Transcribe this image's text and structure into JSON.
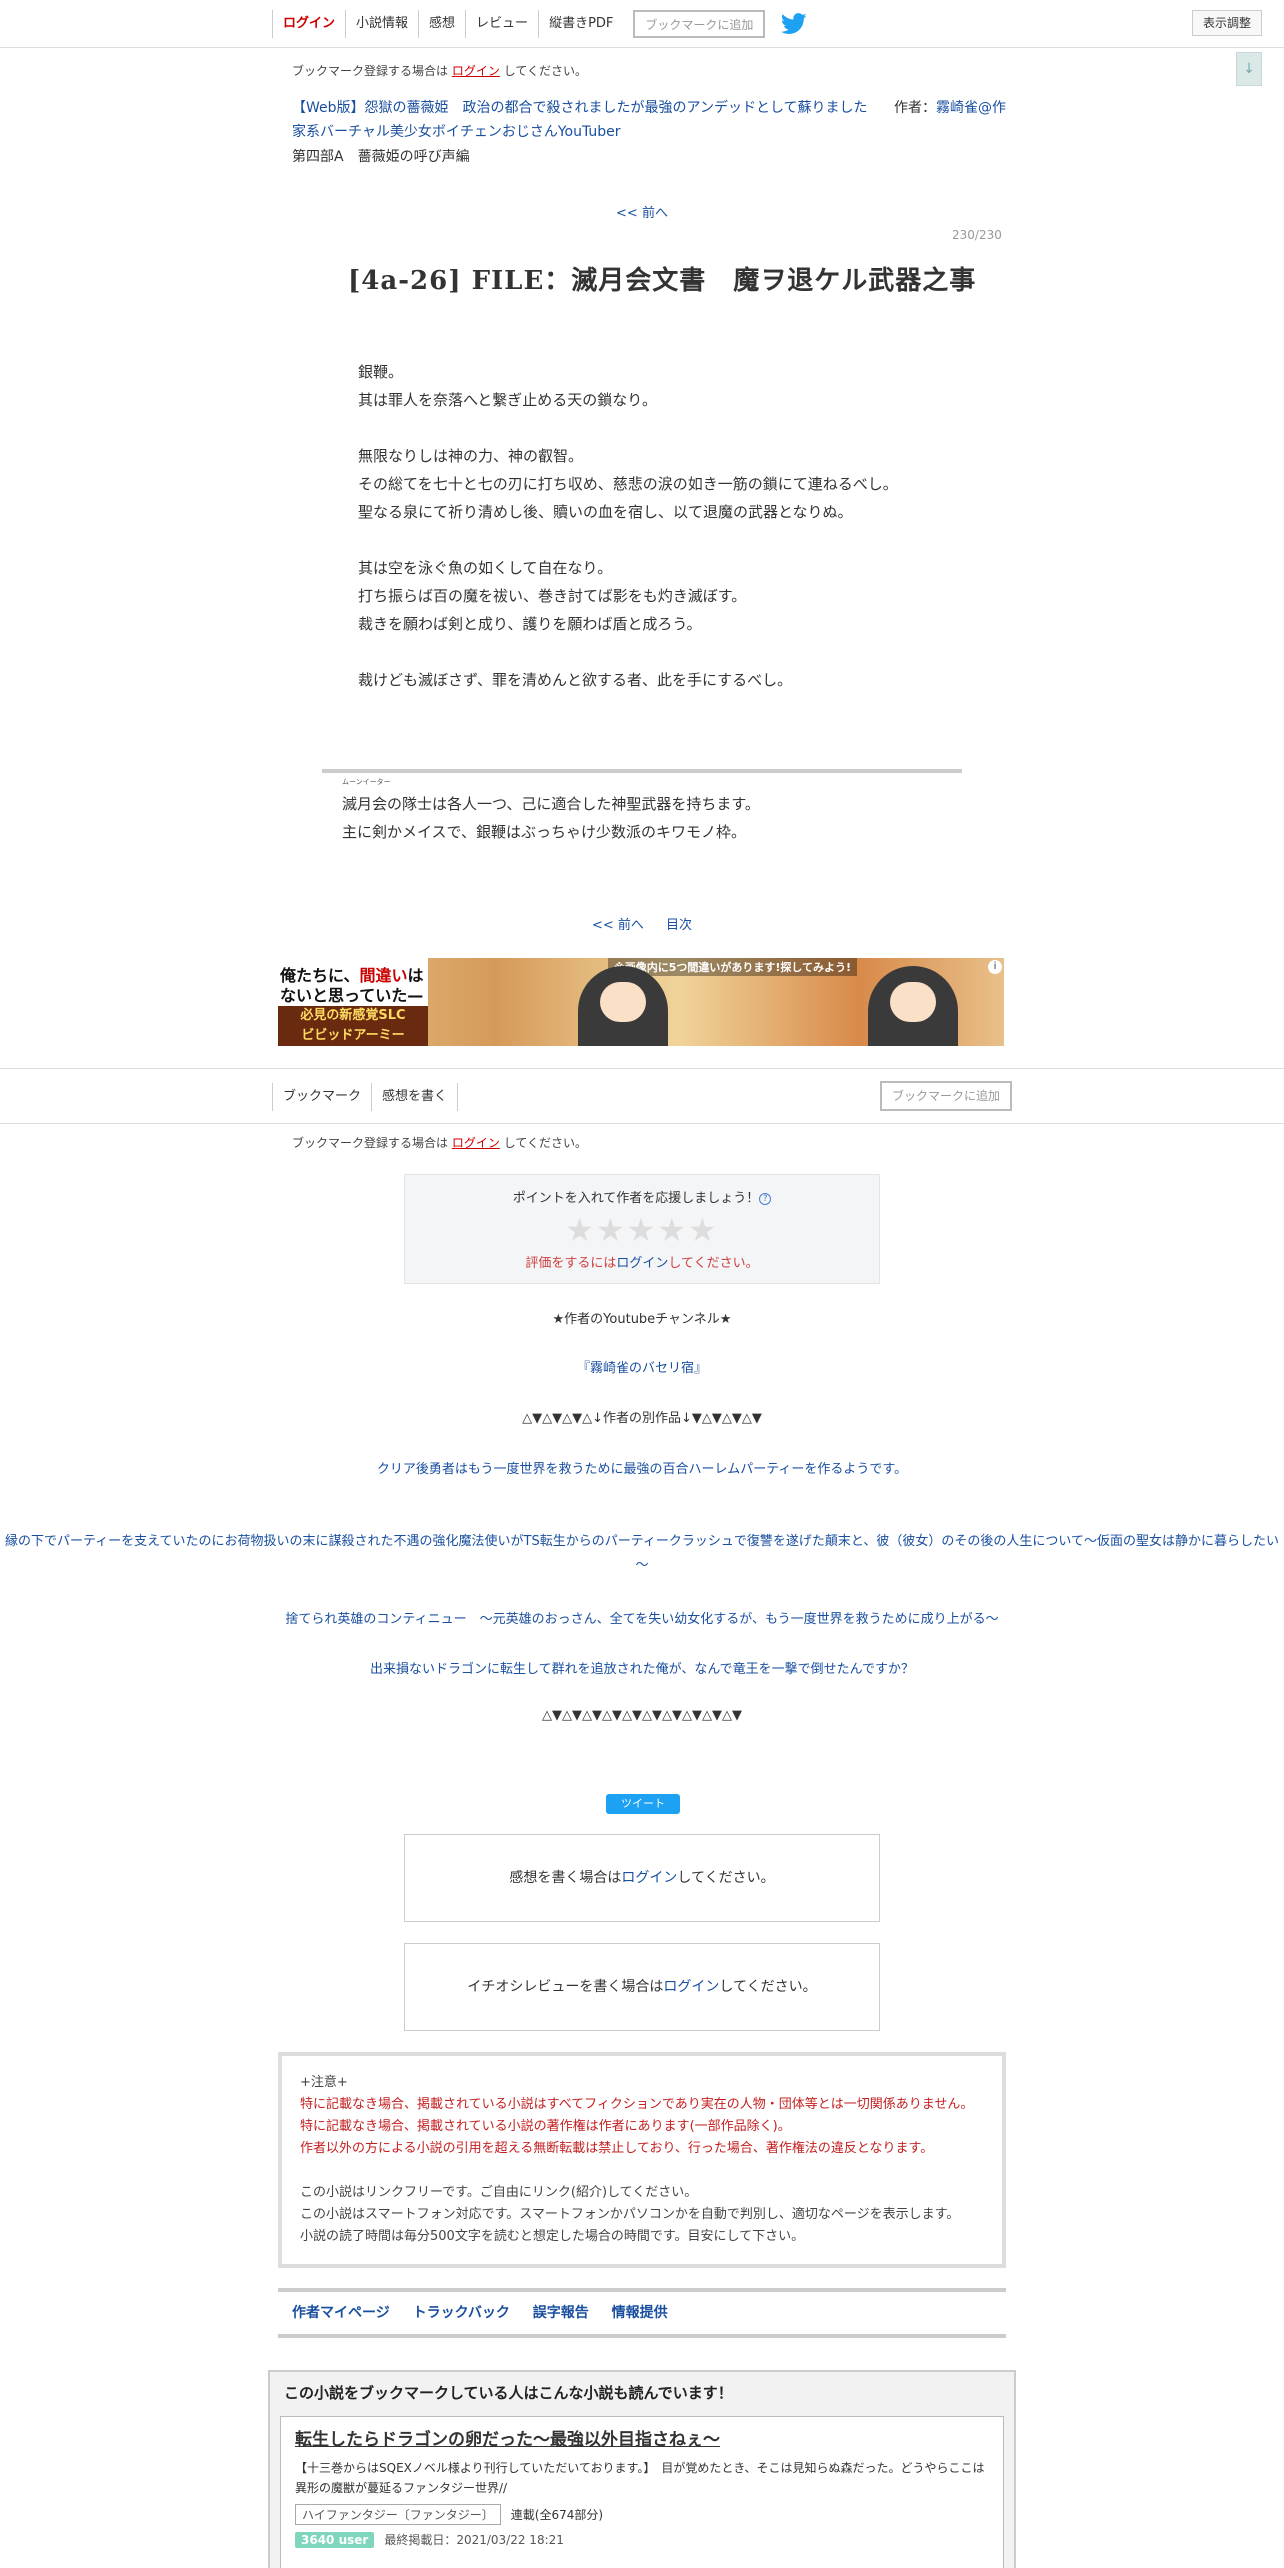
{
  "topnav": {
    "login": "ログイン",
    "novel_info": "小説情報",
    "impressions": "感想",
    "review": "レビュー",
    "vertical_pdf": "縦書きPDF",
    "bookmark_add": "ブックマークに追加",
    "display_settings": "表示調整",
    "scroll_arrow": "↓"
  },
  "bookmark_note": {
    "before": "ブックマーク登録する場合は",
    "login": "ログイン",
    "after": "してください。"
  },
  "novel": {
    "title": "【Web版】怨獄の薔薇姫　政治の都合で殺されましたが最強のアンデッドとして蘇りました",
    "author_label": "作者：",
    "author": "霧崎雀@作家系バーチャル美少女ボイチェンおじさんYouTuber",
    "chapter": "第四部A　薔薇姫の呼び声編"
  },
  "episode": {
    "prev": "<< 前へ",
    "page_count": "230/230",
    "title": "[4a-26] FILE：滅月会文書　魔ヲ退ケル武器之事",
    "body": [
      "銀鞭。",
      "其は罪人を奈落へと繋ぎ止める天の鎖なり。",
      "",
      "無限なりしは神の力、神の叡智。",
      "その総てを七十と七の刃に打ち収め、慈悲の涙の如き一筋の鎖にて連ねるべし。",
      "聖なる泉にて祈り清めし後、贖いの血を宿し、以て退魔の武器となりぬ。",
      "",
      "其は空を泳ぐ魚の如くして自在なり。",
      "打ち振らば百の魔を祓い、巻き討てば影をも灼き滅ぼす。",
      "裁きを願わば剣と成り、護りを願わば盾と成ろう。",
      "",
      "裁けども滅ぼさず、罪を清めんと欲する者、此を手にするべし。"
    ],
    "postscript_ruby_base": "滅月会",
    "postscript_ruby_text": "ムーンイーター",
    "postscript_line1_rest": "の隊士は各人一つ、己に適合した神聖武器を持ちます。",
    "postscript_line2": "主に剣かメイスで、銀鞭はぶっちゃけ少数派のキワモノ枠。",
    "bottom_prev": "<< 前へ",
    "toc": "目次"
  },
  "ad": {
    "line1_a": "俺たちに、",
    "line1_b": "間違い",
    "line1_c": "は",
    "line2": "ないと思っていた—",
    "line3": "必見の新感覚SLC",
    "line4": "ビビッドアーミー",
    "top_text": "※画像内に5つ間違いがあります!探してみよう!",
    "info": "i"
  },
  "subnav": {
    "bookmark": "ブックマーク",
    "write_impression": "感想を書く",
    "bookmark_add": "ブックマークに追加"
  },
  "rating": {
    "question": "ポイントを入れて作者を応援しましょう！",
    "help": "?",
    "stars": "★★★★★",
    "requirement_before": "評価をするには",
    "requirement_login": "ログイン",
    "requirement_after": "してください。"
  },
  "author_links": {
    "youtube_heading": "★作者のYoutubeチャンネル★",
    "youtube_name": "『霧崎雀のバセリ宿』",
    "other_works_heading": "△▼△▼△▼△↓作者の別作品↓▼△▼△▼△▼",
    "works": [
      "クリア後勇者はもう一度世界を救うために最強の百合ハーレムパーティーを作るようです。",
      "縁の下でパーティーを支えていたのにお荷物扱いの末に謀殺された不遇の強化魔法使いがTS転生からのパーティークラッシュで復讐を遂げた顛末と、彼（彼女）のその後の人生について～仮面の聖女は静かに暮らしたい～",
      "捨てられ英雄のコンティニュー　～元英雄のおっさん、全てを失い幼女化するが、もう一度世界を救うために成り上がる～",
      "出来損ないドラゴンに転生して群れを追放された俺が、なんで竜王を一撃で倒せたんですか？"
    ],
    "closing_line": "△▼△▼△▼△▼△▼△▼△▼△▼△▼△▼"
  },
  "tweet": "ツイート",
  "impression_box": {
    "before": "感想を書く場合は",
    "login": "ログイン",
    "after": "してください。"
  },
  "review_box": {
    "before": "イチオシレビューを書く場合は",
    "login": "ログイン",
    "after": "してください。"
  },
  "notice": {
    "heading": "+注意+",
    "red_lines": [
      "特に記載なき場合、掲載されている小説はすべてフィクションであり実在の人物・団体等とは一切関係ありません。",
      "特に記載なき場合、掲載されている小説の著作権は作者にあります(一部作品除く)。",
      "作者以外の方による小説の引用を超える無断転載は禁止しており、行った場合、著作権法の違反となります。"
    ],
    "gray_lines": [
      "この小説はリンクフリーです。ご自由にリンク(紹介)してください。",
      "この小説はスマートフォン対応です。スマートフォンかパソコンかを自動で判別し、適切なページを表示します。",
      "小説の読了時間は毎分500文字を読むと想定した場合の時間です。目安にして下さい。"
    ]
  },
  "footer_links": [
    "作者マイページ",
    "トラックバック",
    "誤字報告",
    "情報提供"
  ],
  "recommend": {
    "heading": "この小説をブックマークしている人はこんな小説も読んでいます！",
    "title": "転生したらドラゴンの卵だった～最強以外目指さねぇ～",
    "description": "【十三巻からはSQEXノベル様より刊行していただいております。】　目が覚めたとき、そこは見知らぬ森だった。どうやらここは異形の魔獣が蔓延るファンタジー世界//",
    "genre": "ハイファンタジー〔ファンタジー〕",
    "status": "連載(全674部分)",
    "users": "3640 user",
    "last_updated": "最終掲載日：2021/03/22 18:21"
  },
  "colors": {
    "link": "#1a4fa0",
    "login_red": "#cc0000",
    "twitter": "#1da1f2",
    "user_badge": "#7fd6bd"
  }
}
